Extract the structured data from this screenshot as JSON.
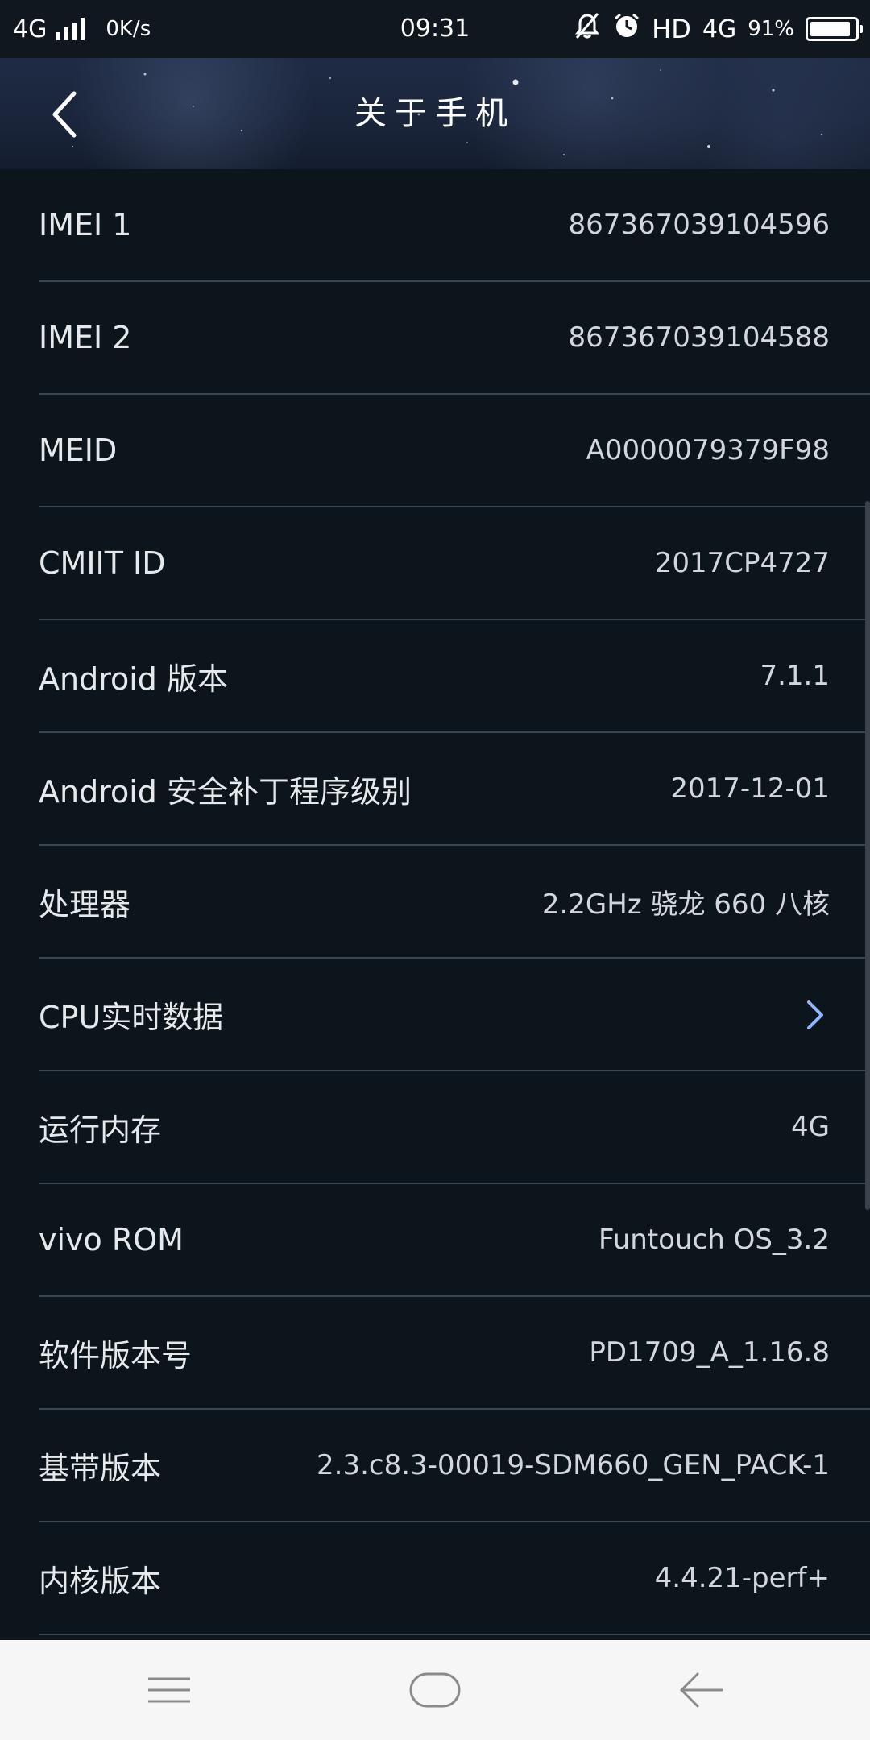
{
  "status_bar": {
    "network": "4G",
    "speed": "0K/s",
    "time": "09:31",
    "hd": "HD",
    "network_right": "4G",
    "battery_percent": "91%",
    "battery_level": 0.91
  },
  "header": {
    "title": "关于手机"
  },
  "rows": [
    {
      "label": "IMEI 1",
      "value": "867367039104596"
    },
    {
      "label": "IMEI 2",
      "value": "867367039104588"
    },
    {
      "label": "MEID",
      "value": "A0000079379F98"
    },
    {
      "label": "CMIIT ID",
      "value": "2017CP4727"
    },
    {
      "label": "Android 版本",
      "value": "7.1.1"
    },
    {
      "label": "Android 安全补丁程序级别",
      "value": "2017-12-01"
    },
    {
      "label": "处理器",
      "value": "2.2GHz 骁龙 660 八核"
    },
    {
      "label": "CPU实时数据",
      "value": ""
    },
    {
      "label": "运行内存",
      "value": "4G"
    },
    {
      "label": "vivo ROM",
      "value": "Funtouch OS_3.2"
    },
    {
      "label": "软件版本号",
      "value": "PD1709_A_1.16.8"
    },
    {
      "label": "基带版本",
      "value": "2.3.c8.3-00019-SDM660_GEN_PACK-1"
    },
    {
      "label": "内核版本",
      "value": "4.4.21-perf+"
    }
  ],
  "icons": {
    "back": "chevron-left-icon",
    "row_chevron": "chevron-right-icon",
    "nav_menu": "menu-icon",
    "nav_home": "home-icon",
    "nav_back": "back-arrow-icon"
  },
  "colors": {
    "background": "#0c141c",
    "divider": "#3b4550",
    "chevron_accent": "#8fb8ff",
    "nav_bar": "#f6f6f6"
  }
}
